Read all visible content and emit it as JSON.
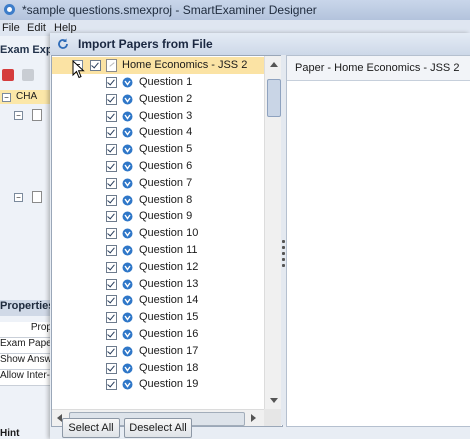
{
  "app": {
    "title": "*sample questions.smexproj - SmartExaminer Designer",
    "menu": [
      "File",
      "Edit",
      "Help"
    ],
    "explorer_label": "Exam Explo",
    "tree_root": "CHA",
    "properties_label": "Properties",
    "properties_rows": [
      "Prop",
      "Exam Paper",
      "Show Answ",
      "Allow Inter-"
    ],
    "hint_label": "Hint"
  },
  "dialog": {
    "title": "Import Papers from File",
    "paper_node": "Home Economics - JSS 2",
    "questions": [
      "Question 1",
      "Question 2",
      "Question 3",
      "Question 4",
      "Question 5",
      "Question 6",
      "Question 7",
      "Question 8",
      "Question 9",
      "Question 10",
      "Question 11",
      "Question 12",
      "Question 13",
      "Question 14",
      "Question 15",
      "Question 16",
      "Question 17",
      "Question 18",
      "Question 19"
    ],
    "right_header": "Paper - Home Economics - JSS 2",
    "select_all": "Select All",
    "deselect_all": "Deselect All"
  }
}
